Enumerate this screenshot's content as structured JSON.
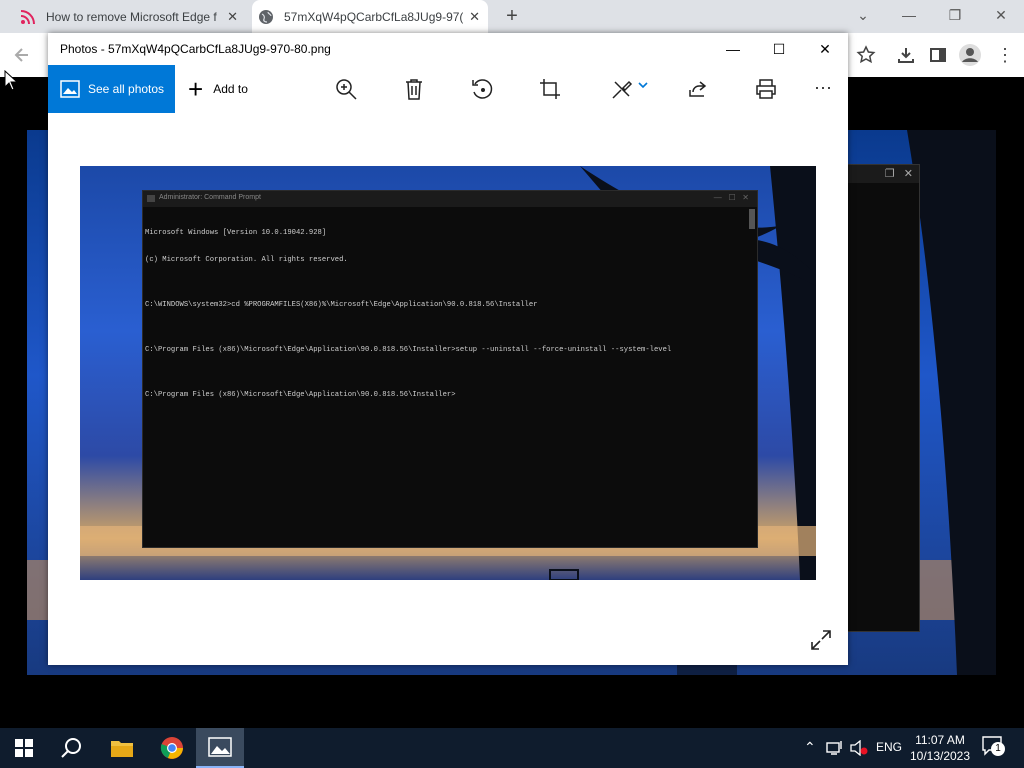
{
  "chrome": {
    "tabs": [
      {
        "title": "How to remove Microsoft Edge f"
      },
      {
        "title": "57mXqW4pQCarbCfLa8JUg9-97("
      }
    ]
  },
  "photos": {
    "title": "Photos - 57mXqW4pQCarbCfLa8JUg9-970-80.png",
    "toolbar": {
      "see_all": "See all photos",
      "add_to": "Add to"
    }
  },
  "cmd": {
    "title": "Administrator: Command Prompt",
    "lines": [
      "Microsoft Windows [Version 10.0.19042.928]",
      "(c) Microsoft Corporation. All rights reserved.",
      "",
      "C:\\WINDOWS\\system32>cd %PROGRAMFILES(X86)%\\Microsoft\\Edge\\Application\\90.0.818.56\\Installer",
      "",
      "C:\\Program Files (x86)\\Microsoft\\Edge\\Application\\90.0.818.56\\Installer>setup --uninstall --force-uninstall --system-level",
      "",
      "C:\\Program Files (x86)\\Microsoft\\Edge\\Application\\90.0.818.56\\Installer>"
    ]
  },
  "taskbar": {
    "language": "ENG",
    "time": "11:07 AM",
    "date": "10/13/2023",
    "notifications": "1"
  }
}
